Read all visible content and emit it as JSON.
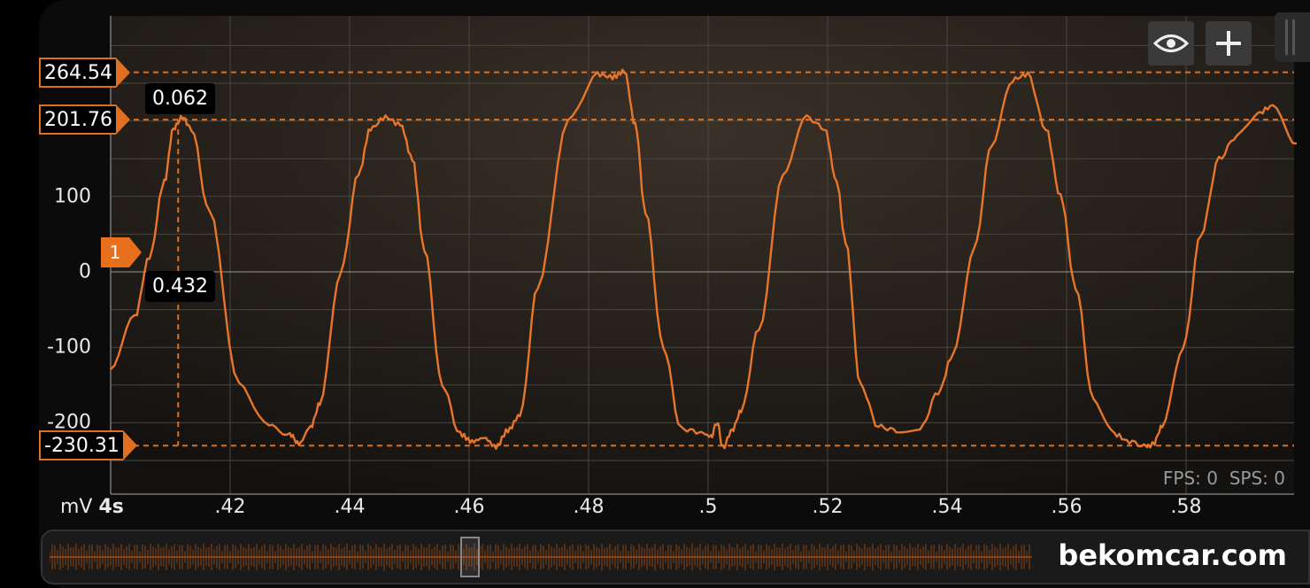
{
  "chart_data": {
    "type": "line",
    "xlabel_unit": "mV",
    "timebase": "4s",
    "x_ticks": [
      ".42",
      ".44",
      ".46",
      ".48",
      ".5",
      ".52",
      ".54",
      ".56",
      ".58"
    ],
    "x_tick_values": [
      0.42,
      0.44,
      0.46,
      0.48,
      0.5,
      0.52,
      0.54,
      0.56,
      0.58
    ],
    "xlim": [
      0.4,
      0.5985
    ],
    "y_ticks": [
      "100",
      "0",
      "-100",
      "-200"
    ],
    "y_tick_values": [
      100,
      0,
      -100,
      -200
    ],
    "ylim": [
      -300,
      360
    ],
    "reference_levels": [
      {
        "label": "264.54",
        "value": 264.54
      },
      {
        "label": "201.76",
        "value": 201.76
      },
      {
        "label": "-230.31",
        "value": -230.31
      }
    ],
    "cursor": {
      "x_value": 0.4113,
      "time_label": "0.062",
      "delta_label": "0.432"
    },
    "channel_marker": {
      "label": "1",
      "value": 0
    },
    "series": [
      {
        "color": "#e8762a",
        "x": [
          0.4,
          0.404,
          0.4065,
          0.409,
          0.4105,
          0.412,
          0.4135,
          0.4165,
          0.4215,
          0.4265,
          0.43,
          0.4315,
          0.4335,
          0.435,
          0.4385,
          0.4415,
          0.4435,
          0.446,
          0.4485,
          0.4505,
          0.4525,
          0.4555,
          0.4585,
          0.4605,
          0.4625,
          0.4645,
          0.4665,
          0.4685,
          0.4715,
          0.4765,
          0.4815,
          0.484,
          0.486,
          0.4878,
          0.4895,
          0.4925,
          0.4955,
          0.4985,
          0.5005,
          0.5015,
          0.5025,
          0.504,
          0.5055,
          0.5085,
          0.5125,
          0.5165,
          0.5195,
          0.5215,
          0.523,
          0.5255,
          0.5285,
          0.5315,
          0.5355,
          0.5385,
          0.541,
          0.5445,
          0.5475,
          0.551,
          0.5535,
          0.5565,
          0.559,
          0.5615,
          0.5645,
          0.568,
          0.5705,
          0.5735,
          0.5745,
          0.576,
          0.5795,
          0.5825,
          0.5855,
          0.5885,
          0.592,
          0.5945,
          0.5985
        ],
        "y": [
          -130,
          -60,
          20,
          120,
          190,
          205,
          190,
          80,
          -150,
          -205,
          -215,
          -228,
          -205,
          -175,
          0,
          130,
          190,
          205,
          195,
          150,
          30,
          -150,
          -215,
          -225,
          -220,
          -232,
          -210,
          -190,
          -20,
          200,
          262,
          258,
          266,
          195,
          80,
          -100,
          -208,
          -212,
          -218,
          -200,
          -233,
          -210,
          -185,
          -75,
          130,
          205,
          190,
          120,
          40,
          -150,
          -205,
          -210,
          -208,
          -160,
          -110,
          30,
          170,
          255,
          262,
          190,
          100,
          -20,
          -170,
          -215,
          -225,
          -232,
          -228,
          -205,
          -100,
          50,
          150,
          180,
          210,
          220,
          170
        ]
      }
    ]
  },
  "toolbar": {
    "eye_icon": "eye-icon",
    "add_icon": "plus-icon"
  },
  "status": {
    "fps": "FPS: 0",
    "sps": "SPS: 0"
  },
  "watermark": "bekomcar.com"
}
